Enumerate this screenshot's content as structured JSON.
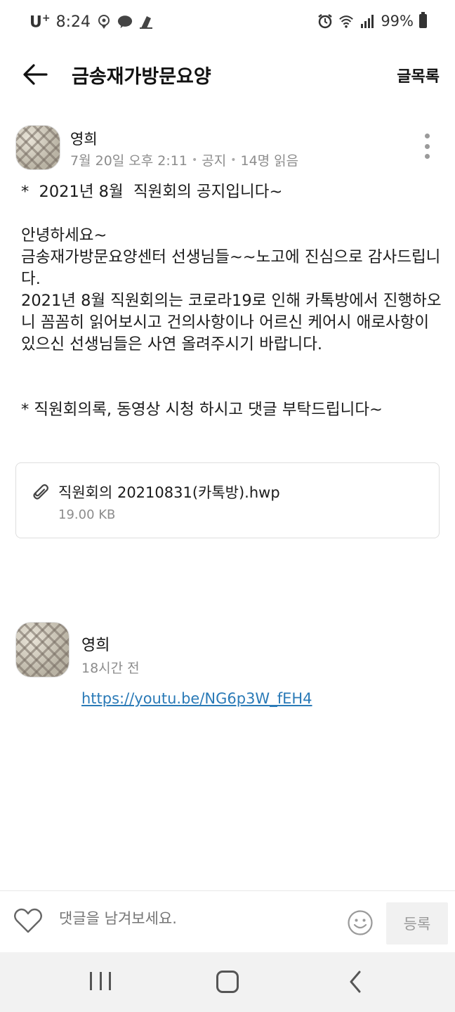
{
  "status_bar": {
    "carrier": "U",
    "carrier_sup": "+",
    "time": "8:24",
    "battery": "99%"
  },
  "header": {
    "title": "금송재가방문요양",
    "list_label": "글목록"
  },
  "post": {
    "author": "영희",
    "date": "7월 20일 오후 2:11",
    "category": "공지",
    "views": "14명 읽음",
    "body": {
      "line1": "*  2021년 8월  직원회의 공지입니다~",
      "para1": "안녕하세요~\n금송재가방문요양센터 선생님들~~노고에 진심으로 감사드립니다.\n2021년 8월 직원회의는 코로라19로 인해 카톡방에서 진행하오니 꼼꼼히 읽어보시고 건의사항이나 어르신 케어시 애로사항이 있으신 선생님들은 사연 올려주시기 바랍니다.",
      "line2": "* 직원회의록, 동영상 시청 하시고 댓글 부탁드립니다~"
    },
    "attachment": {
      "filename": "직원회의 20210831(카톡방).hwp",
      "size": "19.00 KB"
    }
  },
  "comment": {
    "author": "영희",
    "time": "18시간 전",
    "link": "https://youtu.be/NG6p3W_fEH4"
  },
  "comment_bar": {
    "placeholder": "댓글을 남겨보세요.",
    "submit_label": "등록"
  },
  "nav_bar": {
    "icons": [
      "recent-apps-icon",
      "home-icon",
      "back-icon"
    ]
  }
}
